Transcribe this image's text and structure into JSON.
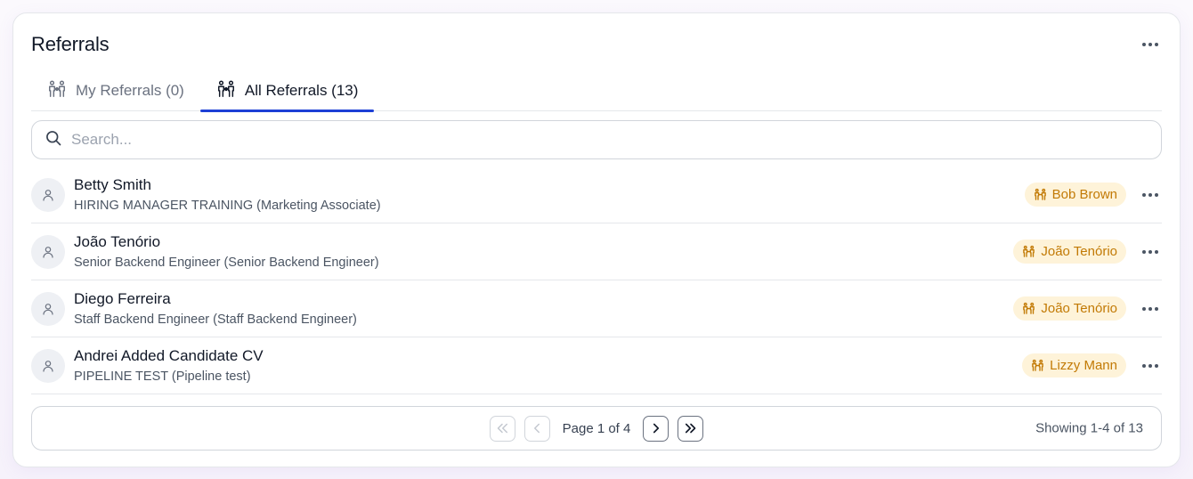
{
  "card": {
    "title": "Referrals"
  },
  "tabs": [
    {
      "label": "My Referrals (0)",
      "active": false
    },
    {
      "label": "All Referrals (13)",
      "active": true
    }
  ],
  "search": {
    "placeholder": "Search...",
    "value": ""
  },
  "rows": [
    {
      "name": "Betty Smith",
      "subtitle": "HIRING MANAGER TRAINING (Marketing Associate)",
      "referrer": "Bob Brown"
    },
    {
      "name": "João Tenório",
      "subtitle": "Senior Backend Engineer (Senior Backend Engineer)",
      "referrer": "João Tenório"
    },
    {
      "name": "Diego Ferreira",
      "subtitle": "Staff Backend Engineer (Staff Backend Engineer)",
      "referrer": "João Tenório"
    },
    {
      "name": "Andrei Added Candidate CV",
      "subtitle": "PIPELINE TEST (Pipeline test)",
      "referrer": "Lizzy Mann"
    }
  ],
  "pagination": {
    "page_label": "Page 1 of 4",
    "showing": "Showing 1-4 of 13"
  },
  "colors": {
    "accent": "#1d3fd6",
    "badge_bg": "#fef3d9",
    "badge_text": "#c27a05"
  },
  "icons": {
    "tab": "referral-people-icon",
    "search": "search-icon",
    "avatar": "user-icon",
    "menu": "more-horizontal-icon"
  }
}
